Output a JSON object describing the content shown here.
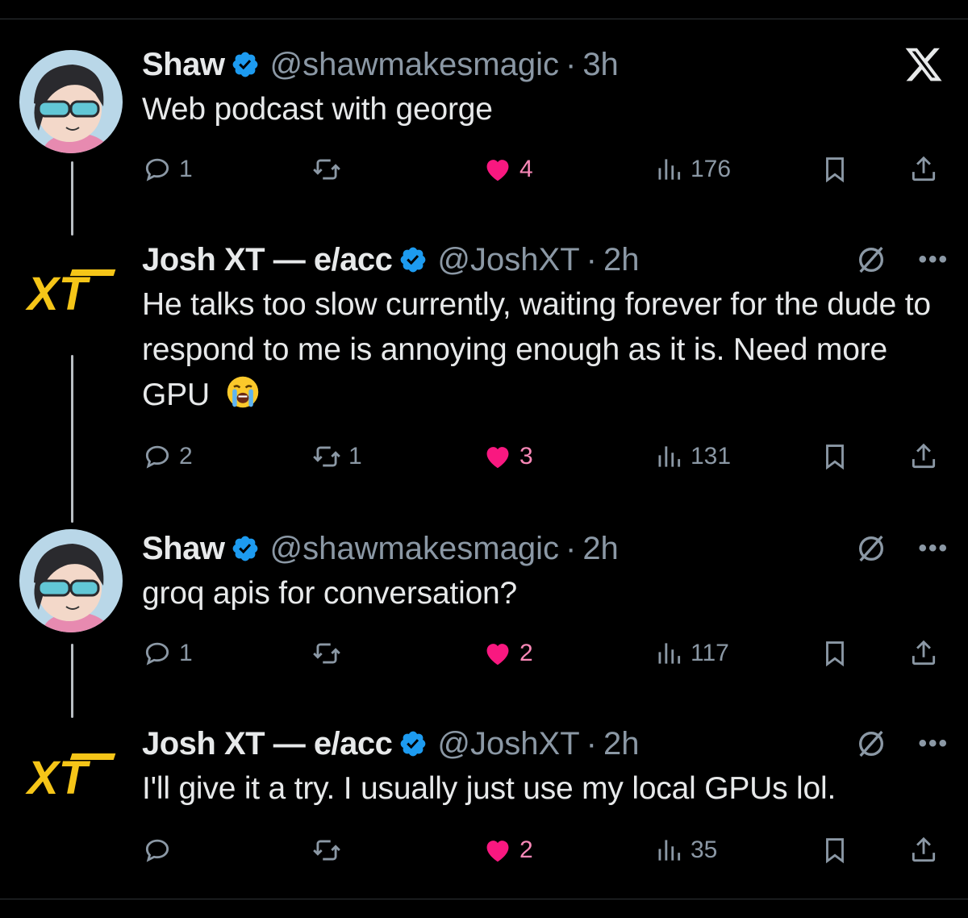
{
  "app": {
    "logo": "x-logo"
  },
  "colors": {
    "background": "#000000",
    "text": "#e7e9ea",
    "muted": "#8b98a5",
    "verified": "#1d9bf0",
    "like": "#f91880",
    "xt_yellow": "#f5c518"
  },
  "tweets": [
    {
      "author": "Shaw",
      "handle": "@shawmakesmagic",
      "dot": "·",
      "time": "3h",
      "text": "Web podcast with george",
      "avatar": "anime-avatar",
      "replies": "1",
      "retweets": "",
      "likes": "4",
      "views": "176"
    },
    {
      "author": "Josh XT — e/acc",
      "handle": "@JoshXT",
      "dot": "·",
      "time": "2h",
      "text": "He talks too slow currently, waiting forever for the dude to respond to me is annoying enough as it is. Need more GPU",
      "emoji": "loudly-crying-face",
      "avatar": "xt-logo",
      "replies": "2",
      "retweets": "1",
      "likes": "3",
      "views": "131"
    },
    {
      "author": "Shaw",
      "handle": "@shawmakesmagic",
      "dot": "·",
      "time": "2h",
      "text": "groq apis for conversation?",
      "avatar": "anime-avatar",
      "replies": "1",
      "retweets": "",
      "likes": "2",
      "views": "117"
    },
    {
      "author": "Josh XT — e/acc",
      "handle": "@JoshXT",
      "dot": "·",
      "time": "2h",
      "text": "I'll give it a try. I usually just use my local GPUs lol.",
      "avatar": "xt-logo",
      "replies": "",
      "retweets": "",
      "likes": "2",
      "views": "35"
    }
  ],
  "xt_logo_text": "XT"
}
